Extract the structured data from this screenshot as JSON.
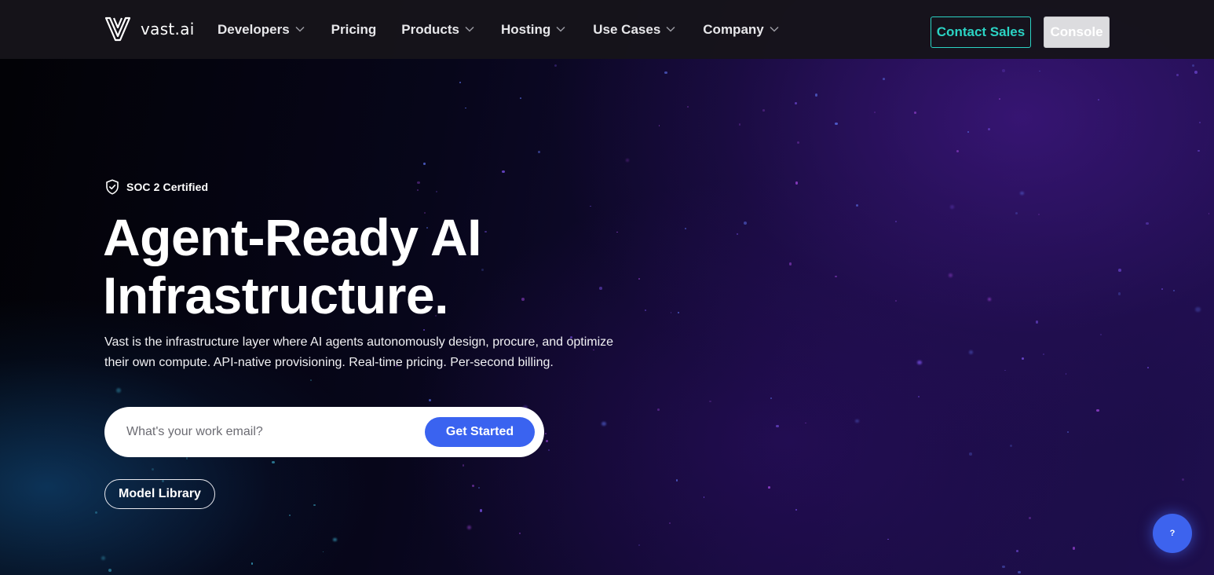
{
  "nav": {
    "logo_text": "vast.ai",
    "items": [
      {
        "label": "Developers",
        "has_dropdown": true
      },
      {
        "label": "Pricing",
        "has_dropdown": false
      },
      {
        "label": "Products",
        "has_dropdown": true
      },
      {
        "label": "Hosting",
        "has_dropdown": true
      },
      {
        "label": "Use Cases",
        "has_dropdown": true
      },
      {
        "label": "Company",
        "has_dropdown": true
      }
    ],
    "contact_label": "Contact Sales",
    "console_label": "Console"
  },
  "hero": {
    "badge": "SOC 2 Certified",
    "headline_line1": "Agent-Ready AI",
    "headline_line2": "Infrastructure.",
    "subtext": "Vast is the infrastructure layer where AI agents autonomously design, procure, and optimize their own compute. API-native provisioning. Real-time pricing. Per-second billing.",
    "email_placeholder": "What's your work email?",
    "cta_label": "Get Started",
    "secondary_label": "Model Library"
  },
  "help": {
    "label": "?"
  },
  "colors": {
    "accent_teal": "#2bd3c4",
    "primary_blue": "#3a63f0",
    "nav_bg": "#16141a"
  }
}
